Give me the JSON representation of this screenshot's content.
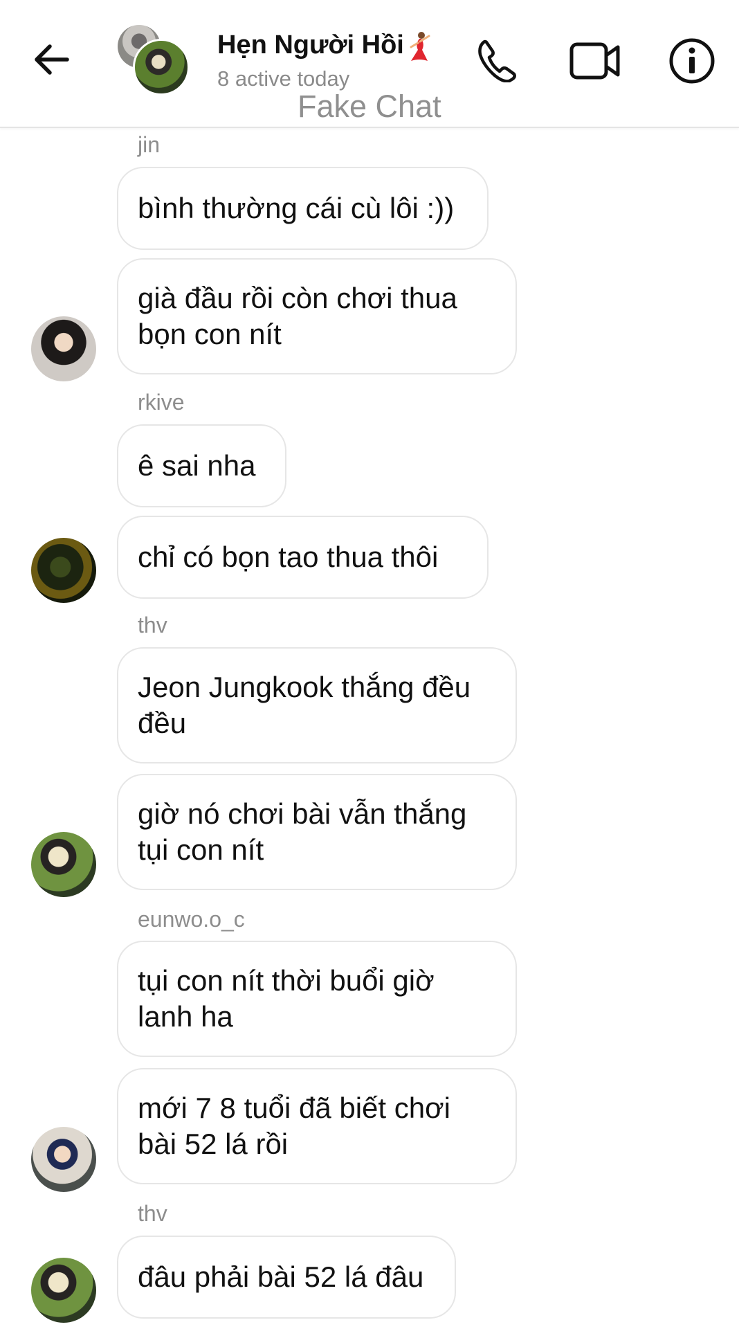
{
  "header": {
    "title": "Hẹn Người Hồi",
    "title_emoji_icon": "dancer-emoji",
    "status": "8 active today",
    "watermark": "Fake Chat",
    "icons": [
      "back-arrow-icon",
      "phone-icon",
      "video-camera-icon",
      "info-icon"
    ]
  },
  "messages": [
    {
      "sender": "jin",
      "text": "bình thường cái cù lôi :))"
    },
    {
      "text": "già đầu rồi còn chơi thua bọn con nít"
    },
    {
      "sender": "rkive",
      "text": "ê sai nha"
    },
    {
      "text": "chỉ có bọn tao thua thôi"
    },
    {
      "sender": "thv",
      "text": "Jeon Jungkook thắng đều đều"
    },
    {
      "text": "giờ nó chơi bài vẫn thắng tụi con nít"
    },
    {
      "sender": "eunwo.o_c",
      "text": "tụi con nít thời buổi giờ lanh ha"
    },
    {
      "text": "mới 7 8 tuổi đã biết chơi bài 52 lá rồi"
    },
    {
      "sender": "thv",
      "text": "đâu phải bài 52 lá đâu"
    }
  ],
  "colors": {
    "header_bg": "#ffffff",
    "bubble_border": "#e6e6e6",
    "meta_text": "#8d8d8d",
    "text": "#111111"
  }
}
